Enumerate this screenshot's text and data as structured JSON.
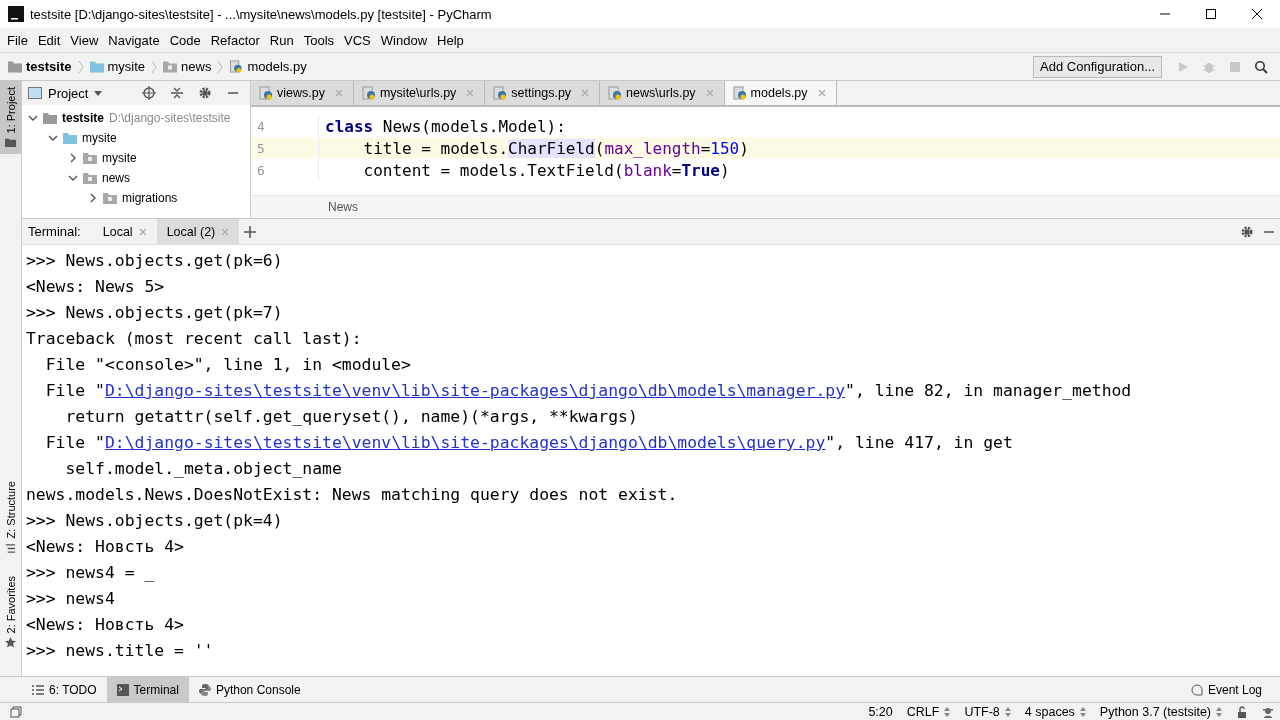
{
  "window": {
    "title": "testsite [D:\\django-sites\\testsite] - ...\\mysite\\news\\models.py [testsite] - PyCharm"
  },
  "menu": [
    "File",
    "Edit",
    "View",
    "Navigate",
    "Code",
    "Refactor",
    "Run",
    "Tools",
    "VCS",
    "Window",
    "Help"
  ],
  "breadcrumbs": [
    {
      "label": "testsite",
      "kind": "root"
    },
    {
      "label": "mysite",
      "kind": "folder"
    },
    {
      "label": "news",
      "kind": "package"
    },
    {
      "label": "models.py",
      "kind": "file"
    }
  ],
  "run_config": "Add Configuration...",
  "side_tabs_top": [
    {
      "label": "1: Project",
      "selected": true
    }
  ],
  "side_tabs_bottom": [
    {
      "label": "Z: Structure",
      "selected": false
    },
    {
      "label": "2: Favorites",
      "selected": false
    }
  ],
  "project_panel": {
    "title": "Project",
    "tree": [
      {
        "label": "testsite",
        "path": "D:\\django-sites\\testsite",
        "kind": "root",
        "expanded": true,
        "children": [
          {
            "label": "mysite",
            "kind": "folder",
            "expanded": true,
            "children": [
              {
                "label": "mysite",
                "kind": "package",
                "expanded": false
              },
              {
                "label": "news",
                "kind": "package",
                "expanded": true,
                "children": [
                  {
                    "label": "migrations",
                    "kind": "package",
                    "expanded": false
                  }
                ]
              }
            ]
          }
        ]
      }
    ]
  },
  "editor_tabs": [
    {
      "label": "views.py",
      "selected": false
    },
    {
      "label": "mysite\\urls.py",
      "selected": false
    },
    {
      "label": "settings.py",
      "selected": false
    },
    {
      "label": "news\\urls.py",
      "selected": false
    },
    {
      "label": "models.py",
      "selected": true
    }
  ],
  "code_lines": [
    {
      "number": "4",
      "current": false,
      "tokens": [
        {
          "kind": "kw",
          "text": "class"
        },
        {
          "kind": "plain",
          "text": " News(models.Model):"
        }
      ]
    },
    {
      "number": "5",
      "current": true,
      "tokens": [
        {
          "kind": "plain",
          "text": "    title = models."
        },
        {
          "kind": "hl",
          "text": "CharField"
        },
        {
          "kind": "plain",
          "text": "("
        },
        {
          "kind": "param",
          "text": "max_length"
        },
        {
          "kind": "plain",
          "text": "="
        },
        {
          "kind": "num",
          "text": "150"
        },
        {
          "kind": "plain",
          "text": ")"
        }
      ]
    },
    {
      "number": "6",
      "current": false,
      "tokens": [
        {
          "kind": "plain",
          "text": "    content = models.TextField("
        },
        {
          "kind": "param",
          "text": "blank"
        },
        {
          "kind": "plain",
          "text": "="
        },
        {
          "kind": "kw",
          "text": "True"
        },
        {
          "kind": "plain",
          "text": ")"
        }
      ]
    }
  ],
  "editor_breadcrumb": "News",
  "terminal": {
    "label": "Terminal:",
    "tabs": [
      {
        "label": "Local",
        "selected": false
      },
      {
        "label": "Local (2)",
        "selected": true
      }
    ],
    "lines": [
      {
        "kind": "text",
        "text": ">>> News.objects.get(pk=6)"
      },
      {
        "kind": "text",
        "text": "<News: News 5>"
      },
      {
        "kind": "text",
        "text": ">>> News.objects.get(pk=7)"
      },
      {
        "kind": "text",
        "text": "Traceback (most recent call last):"
      },
      {
        "kind": "text",
        "text": "  File \"<console>\", line 1, in <module>"
      },
      {
        "kind": "file",
        "pre": "  File \"",
        "link": "D:\\django-sites\\testsite\\venv\\lib\\site-packages\\django\\db\\models\\manager.py",
        "post": "\", line 82, in manager_method"
      },
      {
        "kind": "text",
        "text": "    return getattr(self.get_queryset(), name)(*args, **kwargs)"
      },
      {
        "kind": "file",
        "pre": "  File \"",
        "link": "D:\\django-sites\\testsite\\venv\\lib\\site-packages\\django\\db\\models\\query.py",
        "post": "\", line 417, in get"
      },
      {
        "kind": "text",
        "text": "    self.model._meta.object_name"
      },
      {
        "kind": "text",
        "text": "news.models.News.DoesNotExist: News matching query does not exist."
      },
      {
        "kind": "text",
        "text": ">>> News.objects.get(pk=4)"
      },
      {
        "kind": "text",
        "text": "<News: Новсть 4>"
      },
      {
        "kind": "text",
        "text": ">>> news4 = _"
      },
      {
        "kind": "text",
        "text": ">>> news4"
      },
      {
        "kind": "text",
        "text": "<News: Новсть 4>"
      },
      {
        "kind": "text",
        "text": ">>> news.title = ''"
      }
    ]
  },
  "tool_tabs": [
    {
      "label": "6: TODO",
      "kind": "todo",
      "selected": false
    },
    {
      "label": "Terminal",
      "kind": "terminal",
      "selected": true
    },
    {
      "label": "Python Console",
      "kind": "python",
      "selected": false
    }
  ],
  "event_log": "Event Log",
  "status_bar": [
    {
      "label": "5:20",
      "kind": "plain"
    },
    {
      "label": "CRLF",
      "kind": "select"
    },
    {
      "label": "UTF-8",
      "kind": "select"
    },
    {
      "label": "4 spaces",
      "kind": "select"
    },
    {
      "label": "Python 3.7 (testsite)",
      "kind": "select"
    }
  ]
}
